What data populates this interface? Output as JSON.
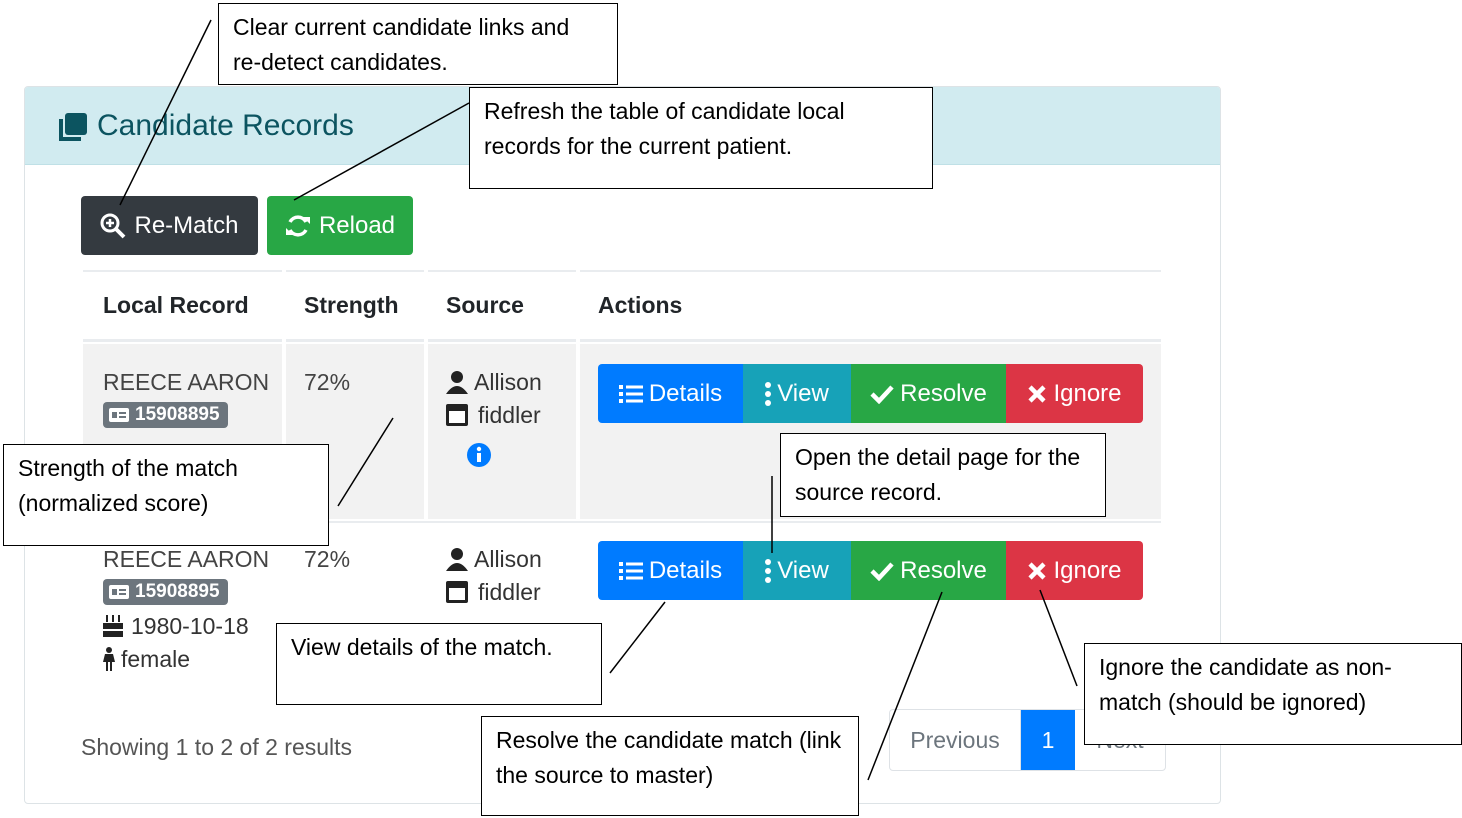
{
  "card": {
    "title": "Candidate Records",
    "header_bg": "#d1ebf0",
    "title_color": "#0c5460"
  },
  "toolbar": {
    "rematch_label": "Re-Match",
    "reload_label": "Reload"
  },
  "table": {
    "headers": [
      "Local Record",
      "Strength",
      "Source",
      "Actions"
    ],
    "rows": [
      {
        "name": "REECE AARON",
        "id_badge": "15908895",
        "strength": "72%",
        "source_user": "Allison",
        "source_app": "fiddler"
      },
      {
        "name": "REECE AARON",
        "id_badge": "15908895",
        "dob": "1980-10-18",
        "gender": "female",
        "strength": "72%",
        "source_user": "Allison",
        "source_app": "fiddler"
      }
    ],
    "actions": {
      "details": "Details",
      "view": "View",
      "resolve": "Resolve",
      "ignore": "Ignore"
    }
  },
  "footer": {
    "info": "Showing 1 to 2 of 2 results",
    "prev": "Previous",
    "page": "1",
    "next": "Next"
  },
  "callouts": {
    "rematch": "Clear current candidate links and re-detect candidates.",
    "reload": "Refresh the table of candidate local records for the current patient.",
    "strength": "Strength of the match (normalized score)",
    "view": "Open the detail page for the source record.",
    "details": "View details of the match.",
    "resolve": "Resolve the candidate match (link the source to master)",
    "ignore": "Ignore the candidate as non-match (should be ignored)"
  },
  "colors": {
    "primary": "#007bff",
    "info": "#17a2b8",
    "success": "#28a745",
    "danger": "#dc3545",
    "dark": "#343a40",
    "secondary": "#6c757d"
  }
}
